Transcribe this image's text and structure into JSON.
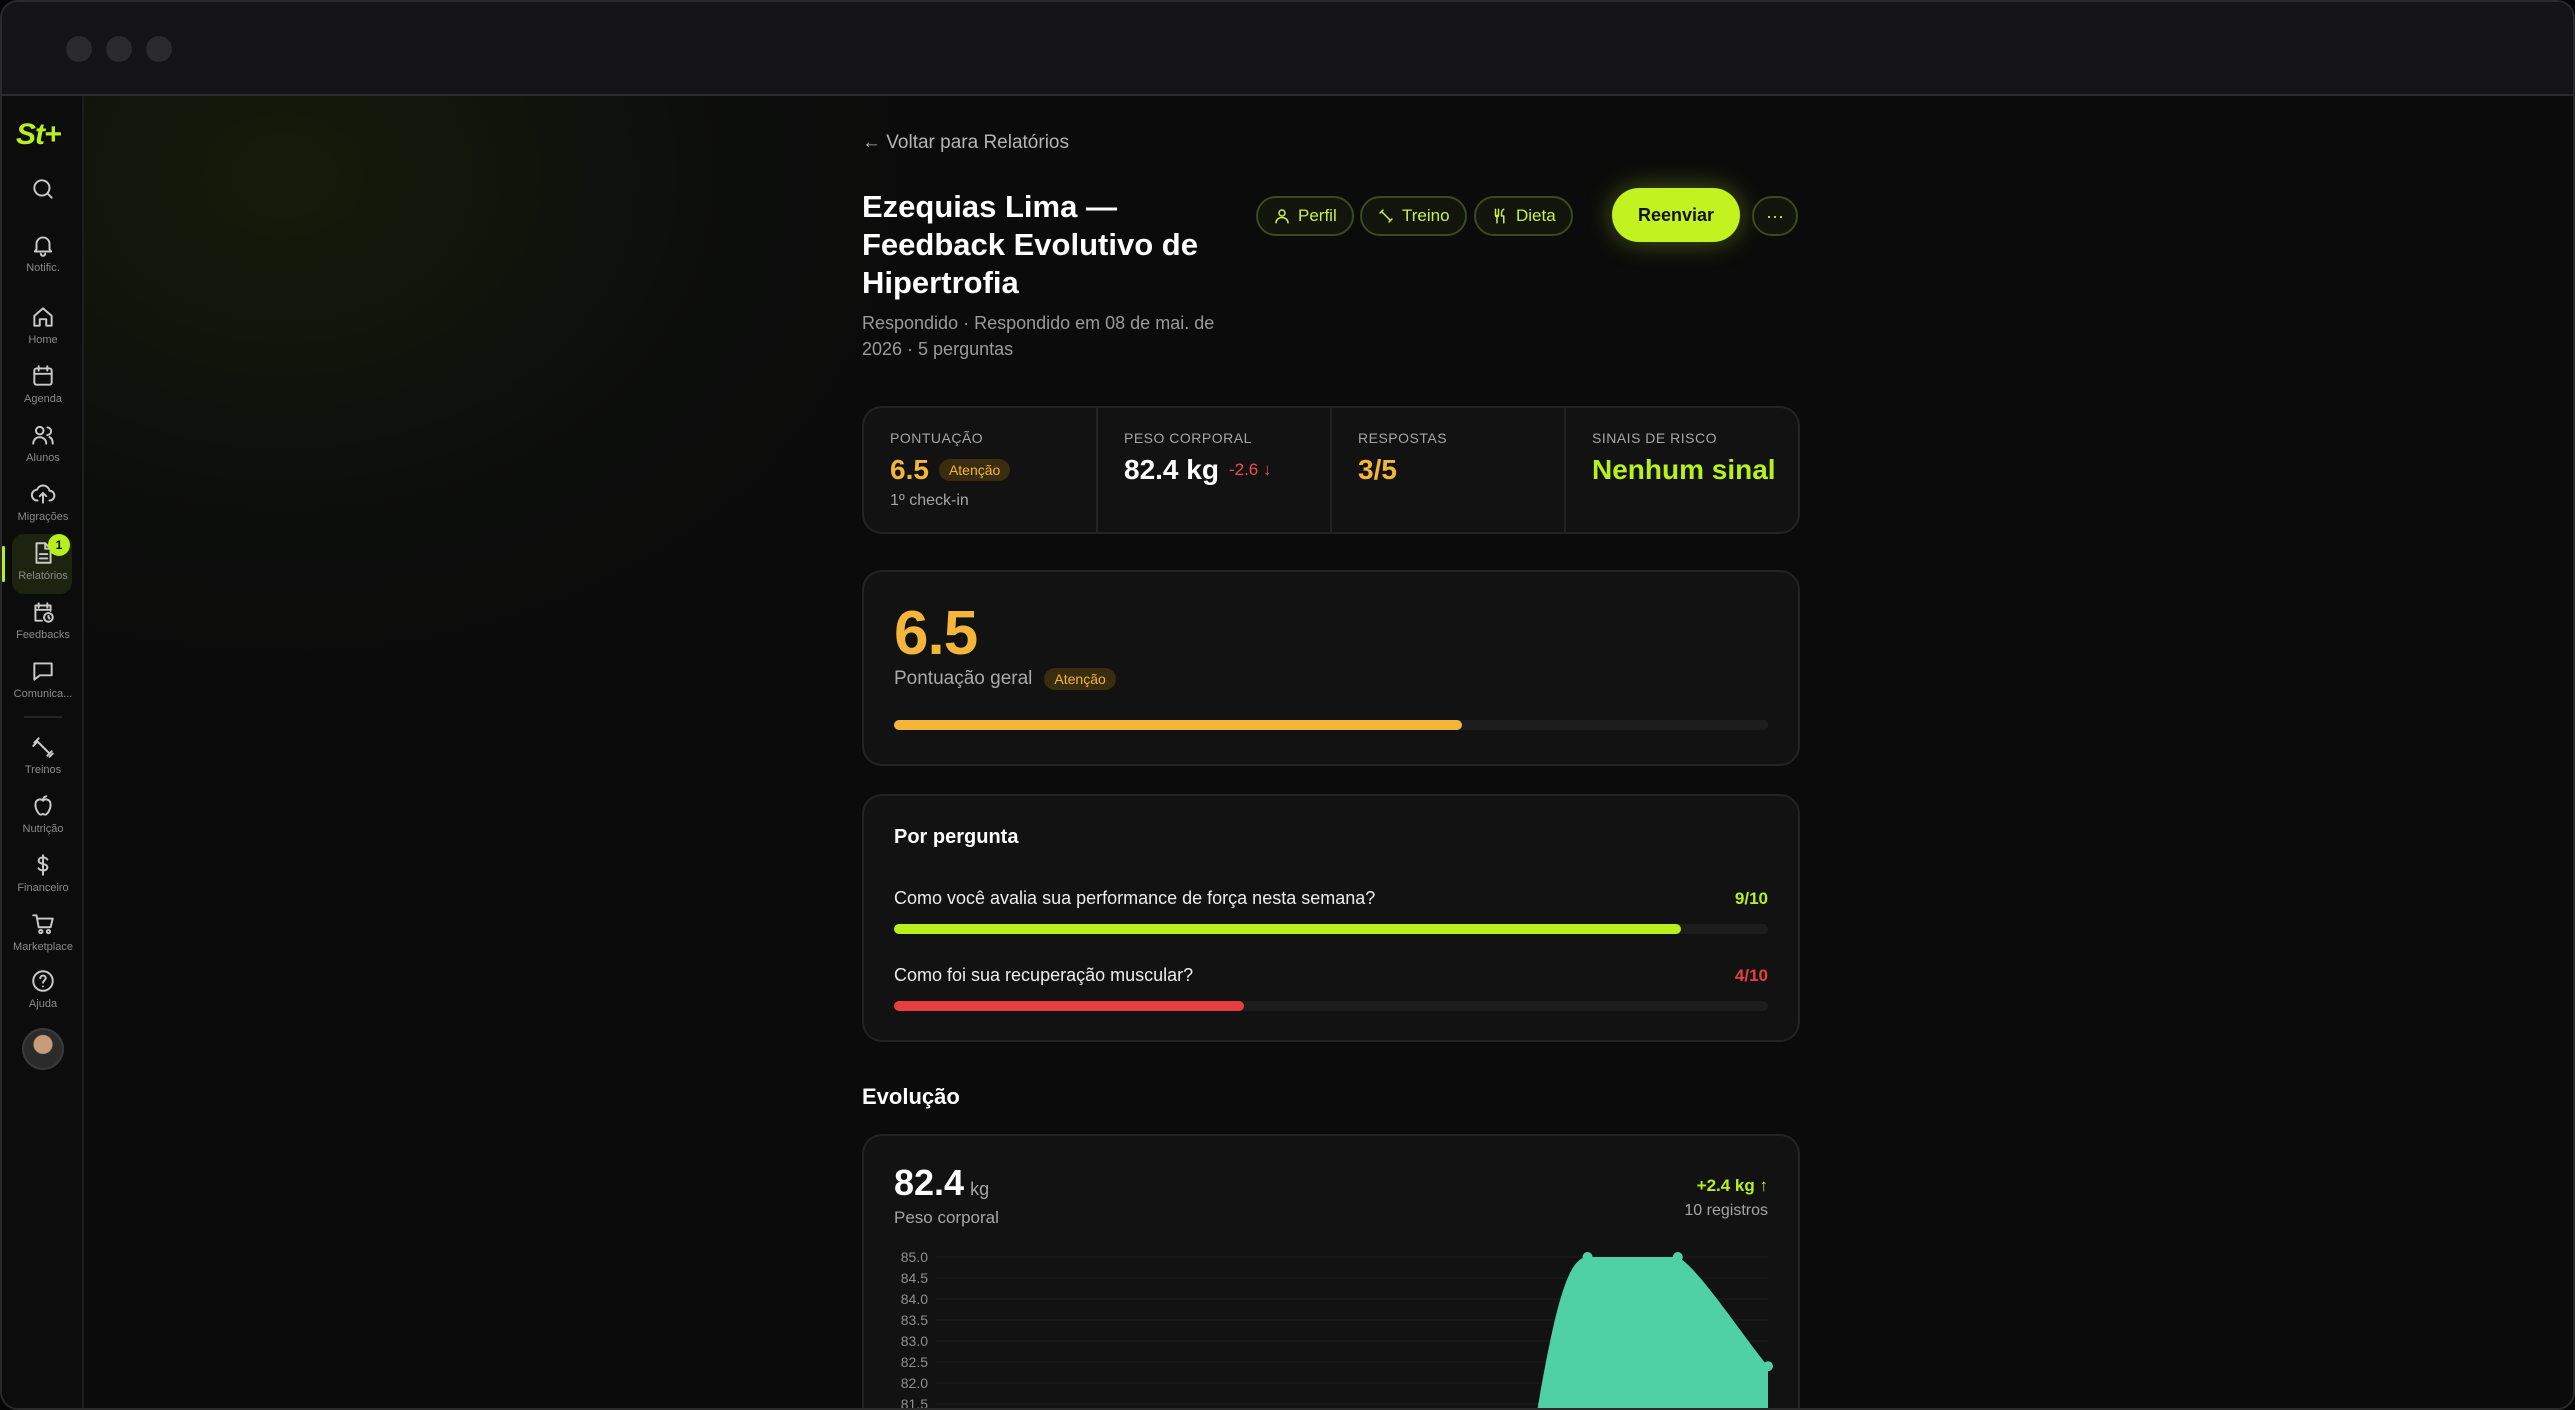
{
  "app": {
    "logo": "St+"
  },
  "sidebar": {
    "items": [
      {
        "icon": "search-icon",
        "label": ""
      },
      {
        "icon": "bell-icon",
        "label": "Notific."
      },
      {
        "icon": "home-icon",
        "label": "Home"
      },
      {
        "icon": "calendar-icon",
        "label": "Agenda"
      },
      {
        "icon": "users-icon",
        "label": "Alunos"
      },
      {
        "icon": "upload-cloud-icon",
        "label": "Migrações"
      },
      {
        "icon": "file-text-icon",
        "label": "Relatórios",
        "active": true,
        "badge": "1"
      },
      {
        "icon": "calendar-clock-icon",
        "label": "Feedbacks"
      },
      {
        "icon": "message-icon",
        "label": "Comunica..."
      },
      {
        "icon": "dumbbell-icon",
        "label": "Treinos"
      },
      {
        "icon": "apple-icon",
        "label": "Nutrição"
      },
      {
        "icon": "dollar-icon",
        "label": "Financeiro"
      },
      {
        "icon": "cart-icon",
        "label": "Marketplace"
      },
      {
        "icon": "help-circle-icon",
        "label": "Ajuda"
      }
    ]
  },
  "header": {
    "back_label": "← Voltar para Relatórios",
    "title": "Ezequias Lima — Feedback Evolutivo de Hipertrofia",
    "subtitle": "Respondido · Respondido em 08 de mai. de 2026 · 5 perguntas",
    "chips": {
      "perfil": "Perfil",
      "treino": "Treino",
      "dieta": "Dieta"
    },
    "resend_label": "Reenviar",
    "more_label": "···"
  },
  "stats": {
    "score": {
      "label": "PONTUAÇÃO",
      "value": "6.5",
      "badge": "Atenção",
      "note": "1º check-in"
    },
    "weight": {
      "label": "PESO CORPORAL",
      "value": "82.4 kg",
      "delta": "-2.6 ↓"
    },
    "answers": {
      "label": "RESPOSTAS",
      "value": "3/5"
    },
    "risk": {
      "label": "SINAIS DE RISCO",
      "value": "Nenhum sinal"
    }
  },
  "overall": {
    "score": "6.5",
    "label": "Pontuação geral",
    "badge": "Atenção",
    "progress": 0.65
  },
  "per_question": {
    "title": "Por pergunta",
    "items": [
      {
        "question": "Como você avalia sua performance de força nesta semana?",
        "score_text": "9/10",
        "progress": 0.9
      },
      {
        "question": "Como foi sua recuperação muscular?",
        "score_text": "4/10",
        "progress": 0.4
      }
    ]
  },
  "evolution": {
    "section_title": "Evolução",
    "value": "82.4",
    "unit": "kg",
    "label": "Peso corporal",
    "delta": "+2.4 kg ↑",
    "count": "10 registros"
  },
  "colors": {
    "accent": "#b8f01c",
    "warning": "#f4b63a",
    "danger": "#e5403f",
    "chart_fill": "#4fd1a5",
    "background": "#0b0b0b"
  },
  "chart_data": {
    "type": "area",
    "y_ticks": [
      "85.0",
      "84.5",
      "84.0",
      "83.5",
      "83.0",
      "82.5",
      "82.0",
      "81.5"
    ],
    "ylim": [
      81.5,
      85.0
    ],
    "x_count": 10,
    "visible_points": [
      {
        "x": 7,
        "y": 85.0
      },
      {
        "x": 8,
        "y": 85.0
      },
      {
        "x": 9,
        "y": 82.4
      }
    ],
    "grid": true
  }
}
